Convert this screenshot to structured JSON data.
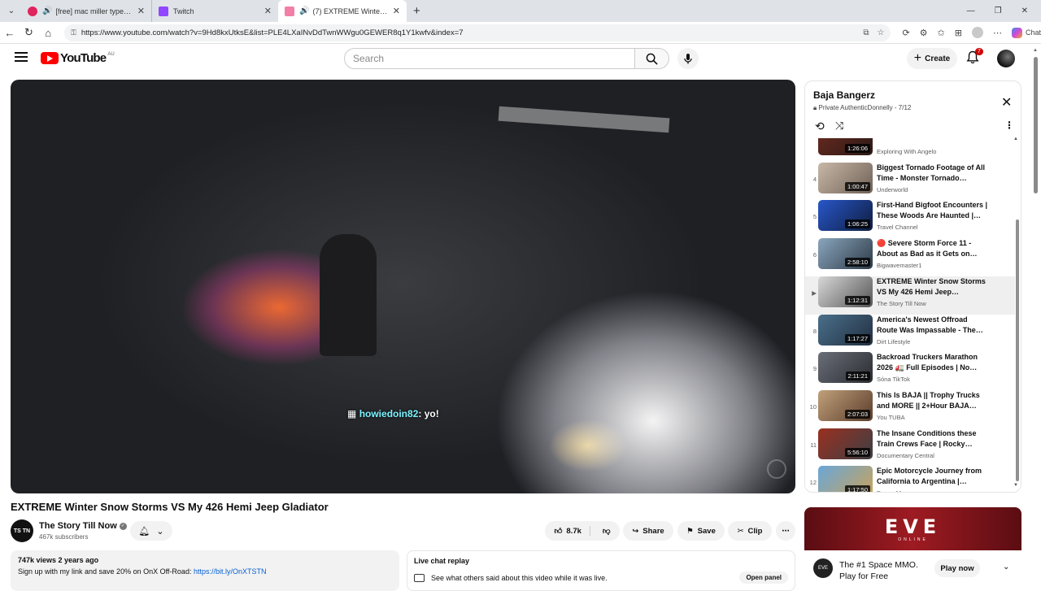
{
  "browser": {
    "tabs": [
      {
        "title": "[free] mac miller type beat \"in",
        "icon_color": "#e0245e",
        "audio": true
      },
      {
        "title": "Twitch",
        "icon_color": "#9146ff",
        "audio": false
      },
      {
        "title": "(7) EXTREME Winter Snow St",
        "icon_color": "#f37fa6",
        "audio": true,
        "active": true
      }
    ],
    "url": "https://www.youtube.com/watch?v=9Hd8kxUtksE&list=PLE4LXaINvDdTwnWWgu0GEWER8q1Y1kwfv&index=7",
    "chat_label": "Chat"
  },
  "header": {
    "logo_text": "YouTube",
    "country_code": "AU",
    "search_placeholder": "Search",
    "create_label": "Create",
    "notification_count": "7"
  },
  "video": {
    "chat_user": "howiedoin82",
    "chat_message": ": yo!",
    "title": "EXTREME Winter Snow Storms VS My 426 Hemi Jeep Gladiator"
  },
  "channel": {
    "avatar_text": "TS TN",
    "name": "The Story Till Now",
    "subscribers": "467k subscribers"
  },
  "actions": {
    "likes": "8.7k",
    "share": "Share",
    "save": "Save",
    "clip": "Clip"
  },
  "description": {
    "meta": "747k views  2 years ago",
    "text": "Sign up with my link and save 20% on OnX Off-Road: ",
    "link": "https://bit.ly/OnXTSTN"
  },
  "live_chat": {
    "title": "Live chat replay",
    "text": "See what others said about this video while it was live.",
    "open_label": "Open panel"
  },
  "playlist": {
    "title": "Baja Bangerz",
    "subtitle": "Private AuthenticDonnelly - 7/12",
    "items": [
      {
        "index": "",
        "title": "",
        "channel": "Exploring With Angelo",
        "duration": "1:26:06",
        "thumb": [
          "#6b2a1f",
          "#2b1a16"
        ]
      },
      {
        "index": "4",
        "title": "Biggest Tornado Footage of All Time - Monster Tornado…",
        "channel": "Underworld",
        "duration": "1:00:47",
        "thumb": [
          "#c8b8a8",
          "#6f6156"
        ]
      },
      {
        "index": "5",
        "title": "First-Hand Bigfoot Encounters | These Woods Are Haunted |…",
        "channel": "Travel Channel",
        "duration": "1:06:25",
        "thumb": [
          "#2857c9",
          "#0f1d3f"
        ]
      },
      {
        "index": "6",
        "title": "🔴 Severe Storm Force 11 - About as Bad as it Gets on…",
        "channel": "Bigwavemaster1",
        "duration": "2:58:10",
        "thumb": [
          "#8aa6bd",
          "#2d3a47"
        ]
      },
      {
        "index": "▶",
        "title": "EXTREME Winter Snow Storms VS My 426 Hemi Jeep…",
        "channel": "The Story Till Now",
        "duration": "1:12:31",
        "thumb": [
          "#d8d8d8",
          "#555555"
        ],
        "current": true
      },
      {
        "index": "8",
        "title": "America's Newest Offroad Route Was Impassable - The…",
        "channel": "Dirt Lifestyle",
        "duration": "1:17:27",
        "thumb": [
          "#4a6f8a",
          "#223041"
        ]
      },
      {
        "index": "9",
        "title": "Backroad Truckers Marathon 2026 🚛 Full Episodes | No…",
        "channel": "Sóna TikTok",
        "duration": "2:11:21",
        "thumb": [
          "#6a6e78",
          "#2a2c31"
        ]
      },
      {
        "index": "10",
        "title": "This Is BAJA || Trophy Trucks and MORE || 2+Hour BAJA…",
        "channel": "You TUBA",
        "duration": "2:07:03",
        "thumb": [
          "#c0a07a",
          "#5b3d2c"
        ]
      },
      {
        "index": "11",
        "title": "The Insane Conditions these Train Crews Face | Rocky…",
        "channel": "Documentary Central",
        "duration": "5:56:10",
        "thumb": [
          "#9a3020",
          "#3c3f45"
        ]
      },
      {
        "index": "12",
        "title": "Epic Motorcycle Journey from California to Argentina |…",
        "channel": "Danny Mcgee",
        "duration": "1:17:50",
        "thumb": [
          "#6aa7d8",
          "#c8a25a"
        ]
      }
    ]
  },
  "ad": {
    "brand": "EVE",
    "brand_sub": "ONLINE",
    "logo_text": "EVE",
    "tagline": "The #1 Space MMO. Play for Free",
    "cta": "Play now"
  }
}
